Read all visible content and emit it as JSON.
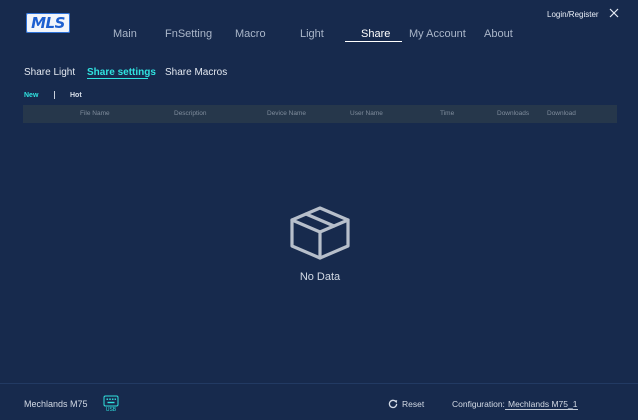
{
  "header": {
    "logo_text": "MLS",
    "login_label": "Login/Register"
  },
  "nav": {
    "items": [
      {
        "label": "Main",
        "active": false
      },
      {
        "label": "FnSetting",
        "active": false
      },
      {
        "label": "Macro",
        "active": false
      },
      {
        "label": "Light",
        "active": false
      },
      {
        "label": "Share",
        "active": true
      },
      {
        "label": "My Account",
        "active": false
      },
      {
        "label": "About",
        "active": false
      }
    ]
  },
  "share": {
    "subtabs": [
      {
        "label": "Share Light",
        "active": false
      },
      {
        "label": "Share settings",
        "active": true
      },
      {
        "label": "Share Macros",
        "active": false
      }
    ],
    "filters": [
      {
        "label": "New",
        "active": true
      },
      {
        "label": "Hot",
        "active": false
      }
    ],
    "table": {
      "columns": [
        "File Name",
        "Description",
        "Device Name",
        "User Name",
        "Time",
        "Downloads",
        "Download"
      ],
      "rows": []
    },
    "empty_text": "No Data"
  },
  "footer": {
    "device_name": "Mechlands M75",
    "usb_label": "USB",
    "reset_label": "Reset",
    "config_label": "Configuration:",
    "config_value": "Mechlands M75_1"
  },
  "colors": {
    "background": "#172a4d",
    "accent": "#30e3e0",
    "table_header_bg": "#26374b",
    "active_nav_text": "#ffffff"
  },
  "icons": {
    "logo": "mls-logo",
    "close": "close-icon",
    "empty": "empty-box-icon",
    "usb": "usb-keyboard-icon",
    "reset": "reset-icon"
  }
}
